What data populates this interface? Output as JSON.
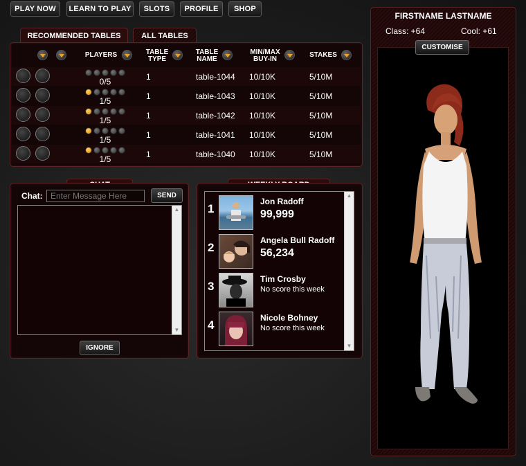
{
  "nav": {
    "play_now": "PLAY NOW",
    "learn_to_play": "LEARN TO PLAY",
    "slots": "SLOTS",
    "profile": "PROFILE",
    "shop": "SHOP"
  },
  "tables": {
    "tabs": [
      "RECOMMENDED TABLES",
      "ALL TABLES"
    ],
    "headers": {
      "players": "PLAYERS",
      "table_type_1": "TABLE",
      "table_type_2": "TYPE",
      "table_name_1": "TABLE",
      "table_name_2": "NAME",
      "buyin_1": "MIN/MAX",
      "buyin_2": "BUY-IN",
      "stakes": "STAKES"
    },
    "rows": [
      {
        "players": "0/5",
        "filled": 0,
        "type": "1",
        "name": "table-1044",
        "buyin": "10/10K",
        "stakes": "5/10M"
      },
      {
        "players": "1/5",
        "filled": 1,
        "type": "1",
        "name": "table-1043",
        "buyin": "10/10K",
        "stakes": "5/10M"
      },
      {
        "players": "1/5",
        "filled": 1,
        "type": "1",
        "name": "table-1042",
        "buyin": "10/10K",
        "stakes": "5/10M"
      },
      {
        "players": "1/5",
        "filled": 1,
        "type": "1",
        "name": "table-1041",
        "buyin": "10/10K",
        "stakes": "5/10M"
      },
      {
        "players": "1/5",
        "filled": 1,
        "type": "1",
        "name": "table-1040",
        "buyin": "10/10K",
        "stakes": "5/10M"
      }
    ]
  },
  "chat": {
    "title": "CHAT",
    "label": "Chat:",
    "placeholder": "Enter Message Here",
    "send": "SEND",
    "ignore": "IGNORE"
  },
  "weekly": {
    "title": "WEEKLY BOARD",
    "entries": [
      {
        "rank": "1",
        "name": "Jon Radoff",
        "score": "99,999",
        "no_score": ""
      },
      {
        "rank": "2",
        "name": "Angela Bull Radoff",
        "score": "56,234",
        "no_score": ""
      },
      {
        "rank": "3",
        "name": "Tim Crosby",
        "score": "",
        "no_score": "No score this week"
      },
      {
        "rank": "4",
        "name": "Nicole Bohney",
        "score": "",
        "no_score": "No score this week"
      }
    ]
  },
  "profile": {
    "name": "FIRSTNAME LASTNAME",
    "class": "Class: +64",
    "cool": "Cool: +61",
    "customise": "CUSTOMISE"
  },
  "colors": {
    "accent": "#f0a020",
    "panel": "#140607",
    "border": "#5a2325"
  }
}
